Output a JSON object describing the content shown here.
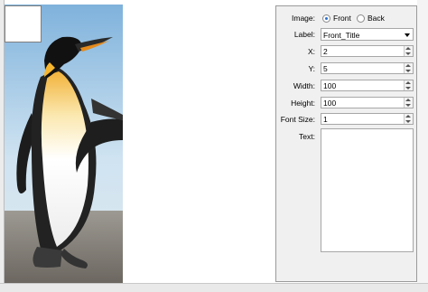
{
  "panel": {
    "image_label": "Image:",
    "image_options": [
      "Front",
      "Back"
    ],
    "image_selected": "Front",
    "label_label": "Label:",
    "label_value": "Front_Title",
    "x_label": "X:",
    "x_value": "2",
    "y_label": "Y:",
    "y_value": "5",
    "width_label": "Width:",
    "width_value": "100",
    "height_label": "Height:",
    "height_value": "100",
    "font_size_label": "Font Size:",
    "font_size_value": "1",
    "text_label": "Text:",
    "text_value": ""
  },
  "colors": {
    "panel_bg": "#f0f0f0",
    "radio_dot": "#2a6fcf"
  }
}
